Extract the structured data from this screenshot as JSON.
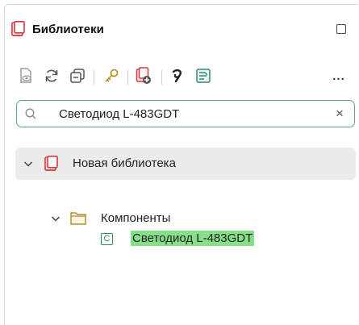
{
  "header": {
    "title": "Библиотеки"
  },
  "toolbar": {
    "more_label": "..."
  },
  "search": {
    "value": "Светодиод L-483GDT",
    "clear_label": "×"
  },
  "tree": {
    "library": {
      "label": "Новая библиотека",
      "expanded": true
    },
    "folder": {
      "label": "Компоненты",
      "expanded": true
    },
    "component": {
      "badge": "C",
      "label": "Светодиод L-483GDT",
      "highlighted": true
    }
  },
  "colors": {
    "accent": "#5aa59a",
    "highlight": "#86e08a",
    "library_red": "#d9363e",
    "component_green": "#2e8b57"
  }
}
